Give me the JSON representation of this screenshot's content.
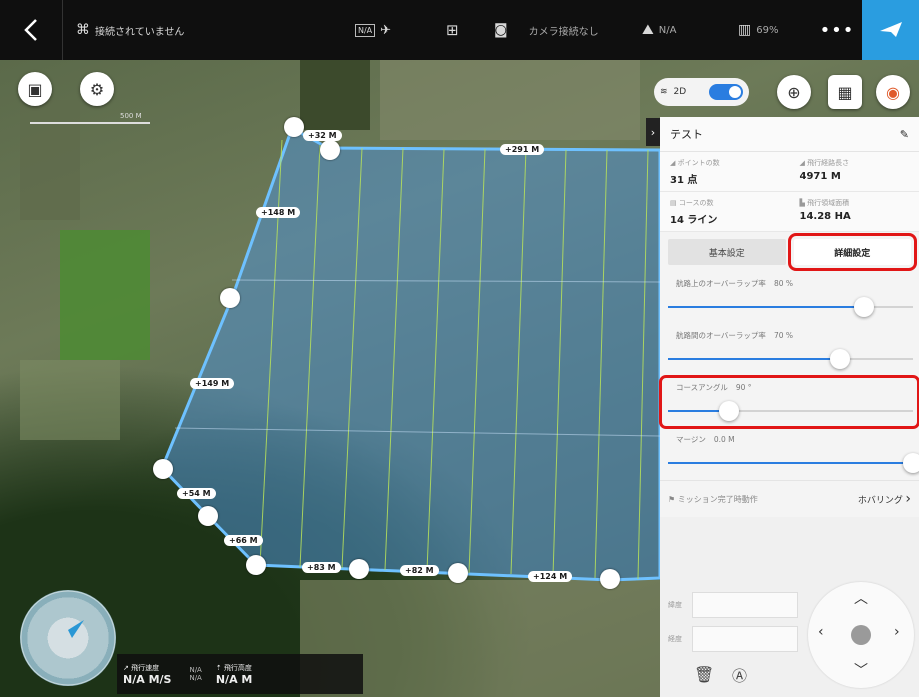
{
  "topbar": {
    "connection": "接続されていません",
    "gps_na": "N/A",
    "camera": "カメラ接続なし",
    "altitude_na": "N/A",
    "battery": "69%",
    "more": "•••"
  },
  "map": {
    "scale": "500 M",
    "toggle_label": "2D",
    "segments": [
      "+32 M",
      "+291 M",
      "+148 M",
      "+149 M",
      "+54 M",
      "+66 M",
      "+83 M",
      "+82 M",
      "+124 M"
    ]
  },
  "panel": {
    "title": "テスト",
    "stats": [
      {
        "label": "ポイントの数",
        "value": "31 点"
      },
      {
        "label": "飛行経路長さ",
        "value": "4971 M"
      },
      {
        "label": "コースの数",
        "value": "14 ライン"
      },
      {
        "label": "飛行領域面積",
        "value": "14.28 HA"
      }
    ],
    "tabs": {
      "basic": "基本設定",
      "advanced": "詳細設定"
    },
    "sliders": [
      {
        "label": "航路上のオーバーラップ率",
        "value": "80 %",
        "fraction": 0.8
      },
      {
        "label": "航路間のオーバーラップ率",
        "value": "70 %",
        "fraction": 0.7
      },
      {
        "label": "コースアングル",
        "value": "90 °",
        "fraction": 0.25
      },
      {
        "label": "マージン",
        "value": "0.0 M",
        "fraction": 1.0
      }
    ],
    "mission": {
      "label": "ミッション完了時動作",
      "value": "ホバリング"
    }
  },
  "controls": {
    "lat_label": "緯度",
    "lon_label": "経度"
  },
  "telemetry": {
    "speed_label": "飛行速度",
    "speed_value": "N/A M/S",
    "alt_label": "飛行高度",
    "alt_value": "N/A M",
    "small_na": "N/A"
  }
}
